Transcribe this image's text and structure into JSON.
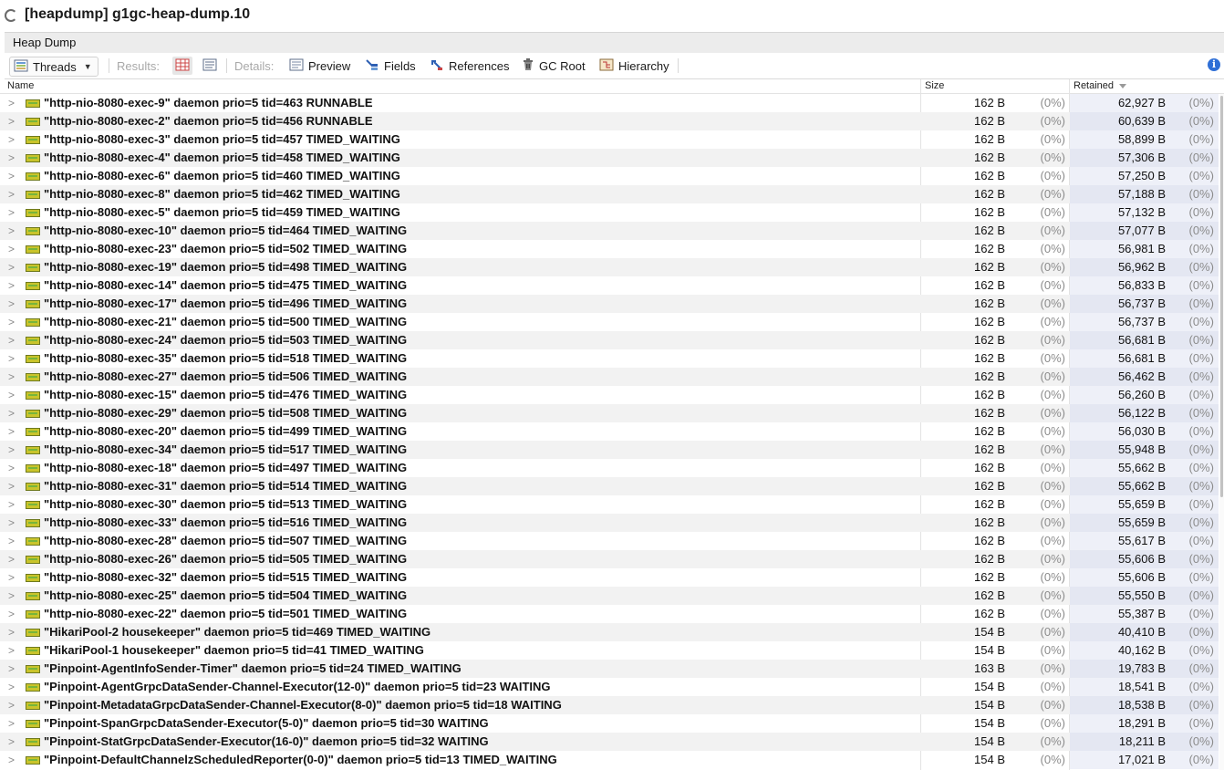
{
  "window": {
    "title": "[heapdump] g1gc-heap-dump.10"
  },
  "tab": {
    "label": "Heap Dump"
  },
  "toolbar": {
    "threads_label": "Threads",
    "results_label": "Results:",
    "details_label": "Details:",
    "preview_label": "Preview",
    "fields_label": "Fields",
    "references_label": "References",
    "gcroot_label": "GC Root",
    "hierarchy_label": "Hierarchy",
    "info_label": "i"
  },
  "columns": {
    "name": "Name",
    "size": "Size",
    "retained": "Retained"
  },
  "rows": [
    {
      "name": "\"http-nio-8080-exec-9\" daemon prio=5 tid=463 RUNNABLE",
      "size": "162 B",
      "size_pct": "(0%)",
      "retained": "62,927 B",
      "retained_pct": "(0%)"
    },
    {
      "name": "\"http-nio-8080-exec-2\" daemon prio=5 tid=456 RUNNABLE",
      "size": "162 B",
      "size_pct": "(0%)",
      "retained": "60,639 B",
      "retained_pct": "(0%)"
    },
    {
      "name": "\"http-nio-8080-exec-3\" daemon prio=5 tid=457 TIMED_WAITING",
      "size": "162 B",
      "size_pct": "(0%)",
      "retained": "58,899 B",
      "retained_pct": "(0%)"
    },
    {
      "name": "\"http-nio-8080-exec-4\" daemon prio=5 tid=458 TIMED_WAITING",
      "size": "162 B",
      "size_pct": "(0%)",
      "retained": "57,306 B",
      "retained_pct": "(0%)"
    },
    {
      "name": "\"http-nio-8080-exec-6\" daemon prio=5 tid=460 TIMED_WAITING",
      "size": "162 B",
      "size_pct": "(0%)",
      "retained": "57,250 B",
      "retained_pct": "(0%)"
    },
    {
      "name": "\"http-nio-8080-exec-8\" daemon prio=5 tid=462 TIMED_WAITING",
      "size": "162 B",
      "size_pct": "(0%)",
      "retained": "57,188 B",
      "retained_pct": "(0%)"
    },
    {
      "name": "\"http-nio-8080-exec-5\" daemon prio=5 tid=459 TIMED_WAITING",
      "size": "162 B",
      "size_pct": "(0%)",
      "retained": "57,132 B",
      "retained_pct": "(0%)"
    },
    {
      "name": "\"http-nio-8080-exec-10\" daemon prio=5 tid=464 TIMED_WAITING",
      "size": "162 B",
      "size_pct": "(0%)",
      "retained": "57,077 B",
      "retained_pct": "(0%)"
    },
    {
      "name": "\"http-nio-8080-exec-23\" daemon prio=5 tid=502 TIMED_WAITING",
      "size": "162 B",
      "size_pct": "(0%)",
      "retained": "56,981 B",
      "retained_pct": "(0%)"
    },
    {
      "name": "\"http-nio-8080-exec-19\" daemon prio=5 tid=498 TIMED_WAITING",
      "size": "162 B",
      "size_pct": "(0%)",
      "retained": "56,962 B",
      "retained_pct": "(0%)"
    },
    {
      "name": "\"http-nio-8080-exec-14\" daemon prio=5 tid=475 TIMED_WAITING",
      "size": "162 B",
      "size_pct": "(0%)",
      "retained": "56,833 B",
      "retained_pct": "(0%)"
    },
    {
      "name": "\"http-nio-8080-exec-17\" daemon prio=5 tid=496 TIMED_WAITING",
      "size": "162 B",
      "size_pct": "(0%)",
      "retained": "56,737 B",
      "retained_pct": "(0%)"
    },
    {
      "name": "\"http-nio-8080-exec-21\" daemon prio=5 tid=500 TIMED_WAITING",
      "size": "162 B",
      "size_pct": "(0%)",
      "retained": "56,737 B",
      "retained_pct": "(0%)"
    },
    {
      "name": "\"http-nio-8080-exec-24\" daemon prio=5 tid=503 TIMED_WAITING",
      "size": "162 B",
      "size_pct": "(0%)",
      "retained": "56,681 B",
      "retained_pct": "(0%)"
    },
    {
      "name": "\"http-nio-8080-exec-35\" daemon prio=5 tid=518 TIMED_WAITING",
      "size": "162 B",
      "size_pct": "(0%)",
      "retained": "56,681 B",
      "retained_pct": "(0%)"
    },
    {
      "name": "\"http-nio-8080-exec-27\" daemon prio=5 tid=506 TIMED_WAITING",
      "size": "162 B",
      "size_pct": "(0%)",
      "retained": "56,462 B",
      "retained_pct": "(0%)"
    },
    {
      "name": "\"http-nio-8080-exec-15\" daemon prio=5 tid=476 TIMED_WAITING",
      "size": "162 B",
      "size_pct": "(0%)",
      "retained": "56,260 B",
      "retained_pct": "(0%)"
    },
    {
      "name": "\"http-nio-8080-exec-29\" daemon prio=5 tid=508 TIMED_WAITING",
      "size": "162 B",
      "size_pct": "(0%)",
      "retained": "56,122 B",
      "retained_pct": "(0%)"
    },
    {
      "name": "\"http-nio-8080-exec-20\" daemon prio=5 tid=499 TIMED_WAITING",
      "size": "162 B",
      "size_pct": "(0%)",
      "retained": "56,030 B",
      "retained_pct": "(0%)"
    },
    {
      "name": "\"http-nio-8080-exec-34\" daemon prio=5 tid=517 TIMED_WAITING",
      "size": "162 B",
      "size_pct": "(0%)",
      "retained": "55,948 B",
      "retained_pct": "(0%)"
    },
    {
      "name": "\"http-nio-8080-exec-18\" daemon prio=5 tid=497 TIMED_WAITING",
      "size": "162 B",
      "size_pct": "(0%)",
      "retained": "55,662 B",
      "retained_pct": "(0%)"
    },
    {
      "name": "\"http-nio-8080-exec-31\" daemon prio=5 tid=514 TIMED_WAITING",
      "size": "162 B",
      "size_pct": "(0%)",
      "retained": "55,662 B",
      "retained_pct": "(0%)"
    },
    {
      "name": "\"http-nio-8080-exec-30\" daemon prio=5 tid=513 TIMED_WAITING",
      "size": "162 B",
      "size_pct": "(0%)",
      "retained": "55,659 B",
      "retained_pct": "(0%)"
    },
    {
      "name": "\"http-nio-8080-exec-33\" daemon prio=5 tid=516 TIMED_WAITING",
      "size": "162 B",
      "size_pct": "(0%)",
      "retained": "55,659 B",
      "retained_pct": "(0%)"
    },
    {
      "name": "\"http-nio-8080-exec-28\" daemon prio=5 tid=507 TIMED_WAITING",
      "size": "162 B",
      "size_pct": "(0%)",
      "retained": "55,617 B",
      "retained_pct": "(0%)"
    },
    {
      "name": "\"http-nio-8080-exec-26\" daemon prio=5 tid=505 TIMED_WAITING",
      "size": "162 B",
      "size_pct": "(0%)",
      "retained": "55,606 B",
      "retained_pct": "(0%)"
    },
    {
      "name": "\"http-nio-8080-exec-32\" daemon prio=5 tid=515 TIMED_WAITING",
      "size": "162 B",
      "size_pct": "(0%)",
      "retained": "55,606 B",
      "retained_pct": "(0%)"
    },
    {
      "name": "\"http-nio-8080-exec-25\" daemon prio=5 tid=504 TIMED_WAITING",
      "size": "162 B",
      "size_pct": "(0%)",
      "retained": "55,550 B",
      "retained_pct": "(0%)"
    },
    {
      "name": "\"http-nio-8080-exec-22\" daemon prio=5 tid=501 TIMED_WAITING",
      "size": "162 B",
      "size_pct": "(0%)",
      "retained": "55,387 B",
      "retained_pct": "(0%)"
    },
    {
      "name": "\"HikariPool-2 housekeeper\" daemon prio=5 tid=469 TIMED_WAITING",
      "size": "154 B",
      "size_pct": "(0%)",
      "retained": "40,410 B",
      "retained_pct": "(0%)"
    },
    {
      "name": "\"HikariPool-1 housekeeper\" daemon prio=5 tid=41 TIMED_WAITING",
      "size": "154 B",
      "size_pct": "(0%)",
      "retained": "40,162 B",
      "retained_pct": "(0%)"
    },
    {
      "name": "\"Pinpoint-AgentInfoSender-Timer\" daemon prio=5 tid=24 TIMED_WAITING",
      "size": "163 B",
      "size_pct": "(0%)",
      "retained": "19,783 B",
      "retained_pct": "(0%)"
    },
    {
      "name": "\"Pinpoint-AgentGrpcDataSender-Channel-Executor(12-0)\" daemon prio=5 tid=23 WAITING",
      "size": "154 B",
      "size_pct": "(0%)",
      "retained": "18,541 B",
      "retained_pct": "(0%)"
    },
    {
      "name": "\"Pinpoint-MetadataGrpcDataSender-Channel-Executor(8-0)\" daemon prio=5 tid=18 WAITING",
      "size": "154 B",
      "size_pct": "(0%)",
      "retained": "18,538 B",
      "retained_pct": "(0%)"
    },
    {
      "name": "\"Pinpoint-SpanGrpcDataSender-Executor(5-0)\" daemon prio=5 tid=30 WAITING",
      "size": "154 B",
      "size_pct": "(0%)",
      "retained": "18,291 B",
      "retained_pct": "(0%)"
    },
    {
      "name": "\"Pinpoint-StatGrpcDataSender-Executor(16-0)\" daemon prio=5 tid=32 WAITING",
      "size": "154 B",
      "size_pct": "(0%)",
      "retained": "18,211 B",
      "retained_pct": "(0%)"
    },
    {
      "name": "\"Pinpoint-DefaultChannelzScheduledReporter(0-0)\" daemon prio=5 tid=13 TIMED_WAITING",
      "size": "154 B",
      "size_pct": "(0%)",
      "retained": "17,021 B",
      "retained_pct": "(0%)"
    }
  ]
}
